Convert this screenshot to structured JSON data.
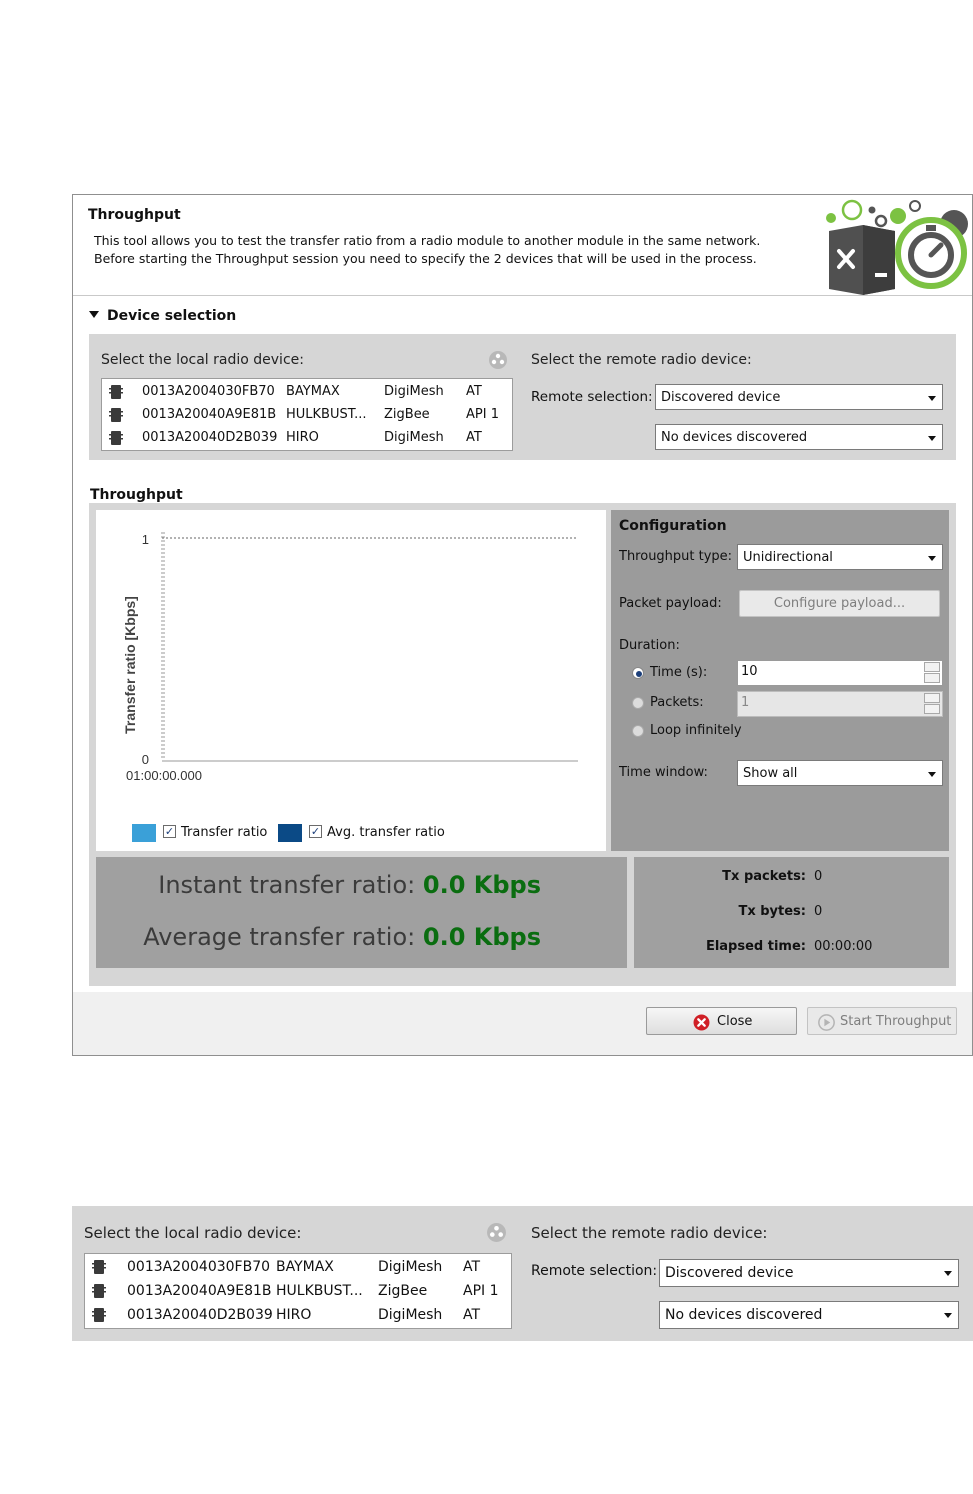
{
  "dialog": {
    "title": "Throughput",
    "description_line1": "This tool allows you to test the transfer ratio from a radio module to another module in the same network.",
    "description_line2": "Before starting the Throughput session you need to specify the 2 devices that will be used in the process."
  },
  "device_selection": {
    "section_title": "Device selection",
    "local_label": "Select the local radio device:",
    "remote_label": "Select the remote radio device:",
    "remote_selection_label": "Remote selection:",
    "remote_selection_value": "Discovered device",
    "discovered_value": "No devices discovered",
    "devices": [
      {
        "address": "0013A2004030FB70",
        "name": "BAYMAX",
        "protocol": "DigiMesh",
        "mode": "AT"
      },
      {
        "address": "0013A20040A9E81B",
        "name": "HULKBUST...",
        "protocol": "ZigBee",
        "mode": "API 1"
      },
      {
        "address": "0013A20040D2B039",
        "name": "HIRO",
        "protocol": "DigiMesh",
        "mode": "AT"
      }
    ]
  },
  "throughput": {
    "section_title": "Throughput",
    "chart_data": {
      "type": "line",
      "ylabel": "Transfer ratio [Kbps]",
      "ylim": [
        0,
        1
      ],
      "y_ticks": [
        "1",
        "0"
      ],
      "x_ticks": [
        "01:00:00.000"
      ],
      "series": [
        {
          "name": "Transfer ratio",
          "values": [],
          "color": "#3aa0d8"
        },
        {
          "name": "Avg. transfer ratio",
          "values": [],
          "color": "#0b4a86"
        }
      ]
    },
    "configuration": {
      "title": "Configuration",
      "throughput_type_label": "Throughput type:",
      "throughput_type_value": "Unidirectional",
      "packet_payload_label": "Packet payload:",
      "configure_payload_button": "Configure payload...",
      "duration_label": "Duration:",
      "time_label": "Time (s):",
      "time_value": "10",
      "packets_label": "Packets:",
      "packets_value": "1",
      "loop_label": "Loop infinitely",
      "time_window_label": "Time window:",
      "time_window_value": "Show all"
    },
    "stats": {
      "instant_label": "Instant transfer ratio:",
      "instant_value": "0.0 Kbps",
      "average_label": "Average transfer ratio:",
      "average_value": "0.0 Kbps"
    },
    "counts": {
      "tx_packets_label": "Tx packets:",
      "tx_packets_value": "0",
      "tx_bytes_label": "Tx bytes:",
      "tx_bytes_value": "0",
      "elapsed_label": "Elapsed time:",
      "elapsed_value": "00:00:00"
    }
  },
  "footer": {
    "close_label": "Close",
    "start_label": "Start Throughput"
  },
  "colors": {
    "accent_green": "#0a6d10",
    "close_red": "#d01f26",
    "logo_green": "#7cc242"
  }
}
